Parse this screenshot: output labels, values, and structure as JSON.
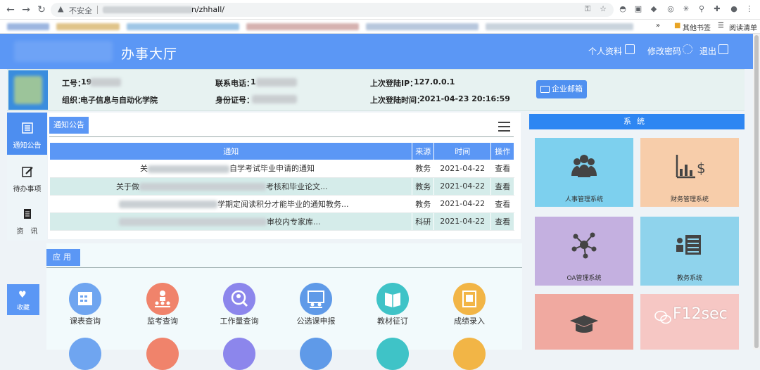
{
  "browser": {
    "insecure_label": "不安全",
    "url_visible": "n/zhhall/",
    "bookmarks_other": "其他书签",
    "reading_list": "阅读清单"
  },
  "header": {
    "title": "办事大厅",
    "profile_label": "个人资料",
    "change_password_label": "修改密码",
    "logout_label": "退出"
  },
  "user": {
    "staff_id_label": "工号：",
    "staff_id_value": "19",
    "org_label": "组织：",
    "org_value": "电子信息与自动化学院",
    "phone_label": "联系电话：",
    "phone_value": "1",
    "id_label": "身份证号：",
    "last_ip_label": "上次登陆IP：",
    "last_ip_value": "127.0.0.1",
    "last_time_label": "上次登陆时间：",
    "last_time_value": "2021-04-23 20:16:59",
    "mail_button": "企业邮箱"
  },
  "left_nav": [
    {
      "label": "通知公告",
      "icon": "list-icon",
      "active": true
    },
    {
      "label": "待办事项",
      "icon": "edit-icon",
      "active": false
    },
    {
      "label": "资　讯",
      "icon": "doc-icon",
      "active": false
    }
  ],
  "favorites_label": "收藏",
  "notice": {
    "tab_label": "通知公告",
    "columns": [
      "通知",
      "来源",
      "时间",
      "操作"
    ],
    "rows": [
      {
        "title_prefix": "关",
        "title_suffix": "自学考试毕业申请的通知",
        "source": "教务",
        "date": "2021-04-22",
        "action": "查看"
      },
      {
        "title_prefix": "关于做",
        "title_suffix": "考核和毕业论文...",
        "source": "教务",
        "date": "2021-04-22",
        "action": "查看"
      },
      {
        "title_prefix": "",
        "title_suffix": "学期定阅读积分才能毕业的通知教务...",
        "source": "教务",
        "date": "2021-04-22",
        "action": "查看"
      },
      {
        "title_prefix": "",
        "title_suffix": "审校内专家库...",
        "source": "科研",
        "date": "2021-04-22",
        "action": "查看"
      }
    ]
  },
  "apps": {
    "tab_label": "应用",
    "items": [
      {
        "label": "课表查询",
        "color": "#6fa5f0",
        "icon": "calendar-icon"
      },
      {
        "label": "监考查询",
        "color": "#f0836b",
        "icon": "invigilate-icon"
      },
      {
        "label": "工作量查询",
        "color": "#8c86ec",
        "icon": "search-person-icon"
      },
      {
        "label": "公选课申报",
        "color": "#5f9ae8",
        "icon": "presentation-icon"
      },
      {
        "label": "教材征订",
        "color": "#3fc3c7",
        "icon": "book-icon"
      },
      {
        "label": "成绩录入",
        "color": "#f2b546",
        "icon": "grade-icon"
      }
    ]
  },
  "systems": {
    "header": "系统",
    "tiles": [
      {
        "label": "人事管理系统",
        "color": "#7dd0ee",
        "icon": "people-icon"
      },
      {
        "label": "财务管理系统",
        "color": "#f7cdaa",
        "icon": "finance-chart-icon"
      },
      {
        "label": "OA管理系统",
        "color": "#c4b0e0",
        "icon": "network-icon"
      },
      {
        "label": "教务系统",
        "color": "#8fd3ec",
        "icon": "roster-icon"
      },
      {
        "label": "",
        "color": "#f0a9a0",
        "icon": "graduation-cap-icon"
      },
      {
        "label": "",
        "color": "#f6c7c4",
        "icon": "blank-icon"
      }
    ]
  },
  "watermark": "F12sec"
}
